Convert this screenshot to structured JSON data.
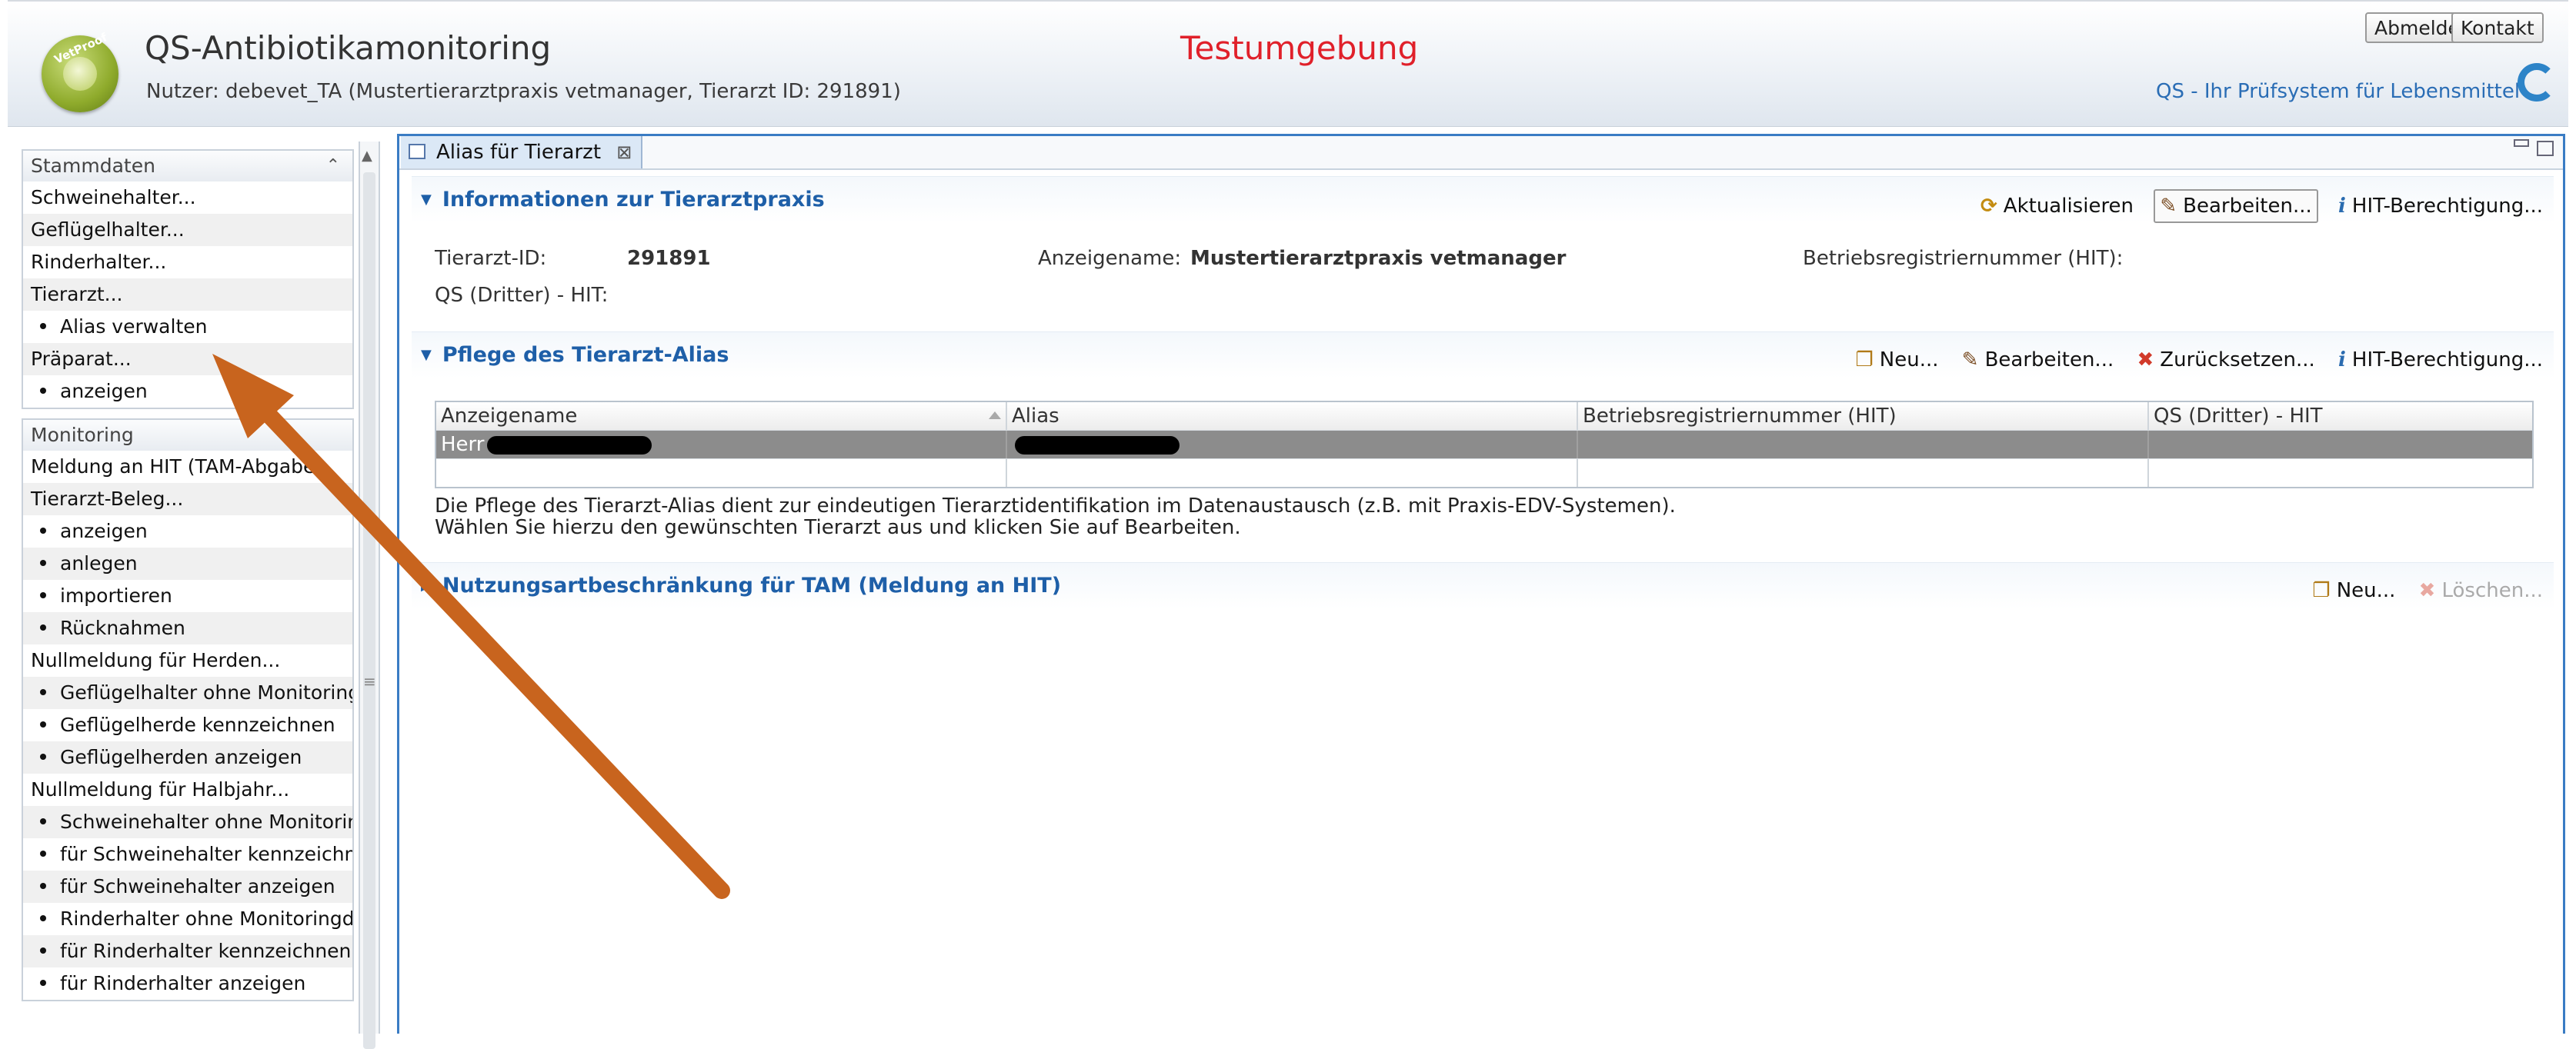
{
  "header": {
    "app_title": "QS-Antibiotikamonitoring",
    "user_line": "Nutzer: debevet_TA (Mustertierarztpraxis vetmanager, Tierarzt ID: 291891)",
    "environment": "Testumgebung",
    "logout": "Abmelden",
    "contact": "Kontakt",
    "slogan": "QS - Ihr Prüfsystem für Lebensmittel",
    "logo_text": "VetProof"
  },
  "sidebar": {
    "stammdaten": {
      "title": "Stammdaten",
      "collapse_icon": "double-chevron-up-icon",
      "items": [
        {
          "label": "Schweinehalter...",
          "sub": false
        },
        {
          "label": "Geflügelhalter...",
          "sub": false
        },
        {
          "label": "Rinderhalter...",
          "sub": false
        },
        {
          "label": "Tierarzt...",
          "sub": false
        },
        {
          "label": "Alias verwalten",
          "sub": true
        },
        {
          "label": "Präparat...",
          "sub": false
        },
        {
          "label": "anzeigen",
          "sub": true
        }
      ]
    },
    "monitoring": {
      "title": "Monitoring",
      "items": [
        {
          "label": "Meldung an HIT (TAM-Abgabe)",
          "sub": false
        },
        {
          "label": "Tierarzt-Beleg...",
          "sub": false
        },
        {
          "label": "anzeigen",
          "sub": true
        },
        {
          "label": "anlegen",
          "sub": true
        },
        {
          "label": "importieren",
          "sub": true
        },
        {
          "label": "Rücknahmen",
          "sub": true
        },
        {
          "label": "Nullmeldung für Herden...",
          "sub": false
        },
        {
          "label": "Geflügelhalter ohne Monitoringd",
          "sub": true
        },
        {
          "label": "Geflügelherde kennzeichnen",
          "sub": true
        },
        {
          "label": "Geflügelherden anzeigen",
          "sub": true
        },
        {
          "label": "Nullmeldung für Halbjahr...",
          "sub": false
        },
        {
          "label": "Schweinehalter ohne Monitoring",
          "sub": true
        },
        {
          "label": "für Schweinehalter kennzeichne",
          "sub": true
        },
        {
          "label": "für Schweinehalter anzeigen",
          "sub": true
        },
        {
          "label": "Rinderhalter ohne Monitoringda",
          "sub": true
        },
        {
          "label": "für Rinderhalter kennzeichnen",
          "sub": true
        },
        {
          "label": "für Rinderhalter anzeigen",
          "sub": true
        }
      ]
    }
  },
  "main": {
    "tab": {
      "label": "Alias für Tierarzt",
      "close_icon": "close-icon"
    },
    "info_section": {
      "title": "Informationen zur Tierarztpraxis",
      "actions": {
        "refresh": "Aktualisieren",
        "edit": "Bearbeiten...",
        "hit": "HIT-Berechtigung..."
      },
      "fields": {
        "tierarzt_id_label": "Tierarzt-ID:",
        "tierarzt_id_value": "291891",
        "anzeigename_label": "Anzeigename:",
        "anzeigename_value": "Mustertierarztpraxis vetmanager",
        "betriebsnr_label": "Betriebsregistriernummer (HIT):",
        "qs_label": "QS (Dritter) - HIT:"
      }
    },
    "alias_section": {
      "title": "Pflege des Tierarzt-Alias",
      "actions": {
        "new": "Neu...",
        "edit": "Bearbeiten...",
        "reset": "Zurücksetzen...",
        "hit": "HIT-Berechtigung..."
      },
      "table": {
        "columns": [
          "Anzeigename",
          "Alias",
          "Betriebsregistriernummer (HIT)",
          "QS (Dritter) - HIT"
        ],
        "rows": [
          {
            "anzeigename": "Herr",
            "alias": "",
            "betriebsnr": "",
            "qs": ""
          }
        ]
      },
      "note_line1": "Die Pflege des Tierarzt-Alias dient zur eindeutigen Tierarztidentifikation im Datenaustausch (z.B. mit Praxis-EDV-Systemen).",
      "note_line2": "Wählen Sie hierzu den gewünschten Tierarzt aus und klicken Sie auf Bearbeiten."
    },
    "nutzung_section": {
      "title": "Nutzungsartbeschränkung für TAM (Meldung an HIT)",
      "actions": {
        "new": "Neu...",
        "delete": "Löschen..."
      }
    }
  },
  "colors": {
    "accent": "#1e5fa8",
    "environment": "#e0202a",
    "arrow": "#c8641e",
    "selected_row": "#8c8c8c"
  }
}
